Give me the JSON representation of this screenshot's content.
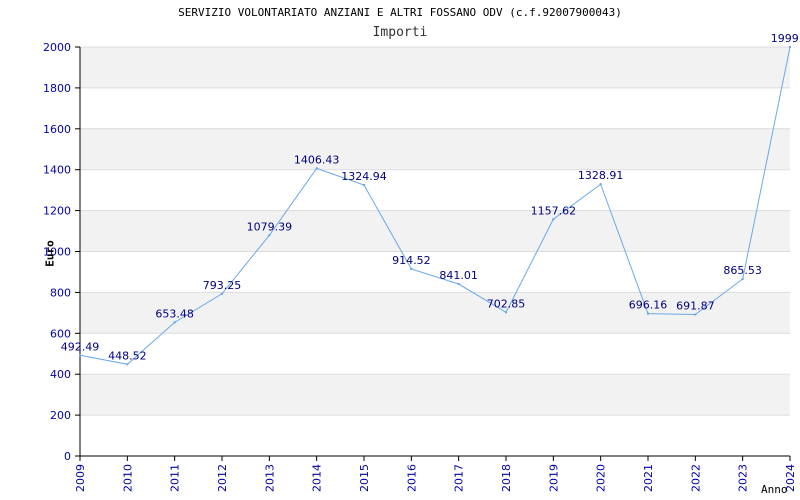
{
  "chart_data": {
    "type": "line",
    "title": "SERVIZIO VOLONTARIATO ANZIANI E ALTRI FOSSANO ODV (c.f.92007900043)",
    "subtitle": "Importi",
    "xlabel": "Anno",
    "ylabel": "Euro",
    "ylim": [
      0,
      2000
    ],
    "yticks": [
      "0",
      "200",
      "400",
      "600",
      "800",
      "1000",
      "1200",
      "1400",
      "1600",
      "1800",
      "2000"
    ],
    "categories": [
      "2009",
      "2010",
      "2011",
      "2012",
      "2013",
      "2014",
      "2015",
      "2016",
      "2017",
      "2018",
      "2019",
      "2020",
      "2021",
      "2022",
      "2023",
      "2024"
    ],
    "values": [
      492.49,
      448.52,
      653.48,
      793.25,
      1079.39,
      1406.43,
      1324.94,
      914.52,
      841.01,
      702.85,
      1157.62,
      1328.91,
      696.16,
      691.87,
      865.53,
      1999.7
    ],
    "value_labels": [
      "492.49",
      "448.52",
      "653.48",
      "793.25",
      "1079.39",
      "1406.43",
      "1324.94",
      "914.52",
      "841.01",
      "702.85",
      "1157.62",
      "1328.91",
      "696.16",
      "691.87",
      "865.53",
      "1999.7"
    ],
    "grid": true,
    "legend": "none",
    "colors": {
      "line": "#6aa8ea",
      "band": "#f2f2f2",
      "gridline": "#dcdcdc",
      "axis": "#000000",
      "ticklabel": "#0000aa",
      "datalabel": "#000080"
    }
  }
}
